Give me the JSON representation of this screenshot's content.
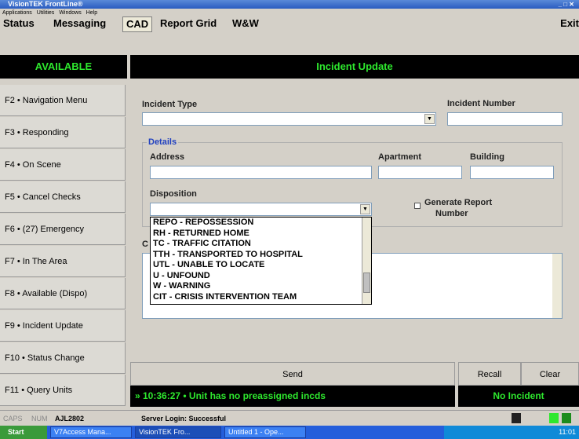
{
  "app": {
    "title": "VisionTEK FrontLine®"
  },
  "menu": [
    "Applications",
    "Utilities",
    "Windows",
    "Help"
  ],
  "tabs": [
    "Status",
    "Messaging",
    "CAD",
    "Report Grid",
    "W&W"
  ],
  "exit_label": "Exit",
  "available": "AVAILABLE",
  "header": "Incident Update",
  "fkeys": [
    "F2 • Navigation Menu",
    "F3 • Responding",
    "F4 • On Scene",
    "F5 • Cancel Checks",
    "F6 • (27) Emergency",
    "F7 • In The Area",
    "F8 • Available (Dispo)",
    "F9 • Incident Update",
    "F10 • Status Change",
    "F11 • Query Units"
  ],
  "form": {
    "incident_type_label": "Incident Type",
    "incident_number_label": "Incident Number",
    "details_label": "Details",
    "address_label": "Address",
    "apartment_label": "Apartment",
    "building_label": "Building",
    "disposition_label": "Disposition",
    "generate_report_label": "Generate Report",
    "generate_report_label2": "Number",
    "comments_label": "C"
  },
  "disposition_options": [
    "REPO - REPOSSESSION",
    "RH - RETURNED HOME",
    "TC - TRAFFIC CITATION",
    "TTH - TRANSPORTED TO HOSPITAL",
    "UTL - UNABLE TO LOCATE",
    "U - UNFOUND",
    "W - WARNING",
    "CIT - CRISIS INTERVENTION TEAM"
  ],
  "buttons": {
    "send": "Send",
    "recall": "Recall",
    "clear": "Clear"
  },
  "status_message": "» 10:36:27 • Unit has no preassigned incds",
  "no_incident": "No Incident",
  "statusbar": {
    "caps": "CAPS",
    "num": "NUM",
    "unit": "AJL2802",
    "server": "Server Login: Successful"
  },
  "taskbar": {
    "start": "Start",
    "tasks": [
      "V7Access Mana...",
      "VisionTEK Fro...",
      "Untitled 1 - Ope..."
    ],
    "time": "11:01"
  }
}
